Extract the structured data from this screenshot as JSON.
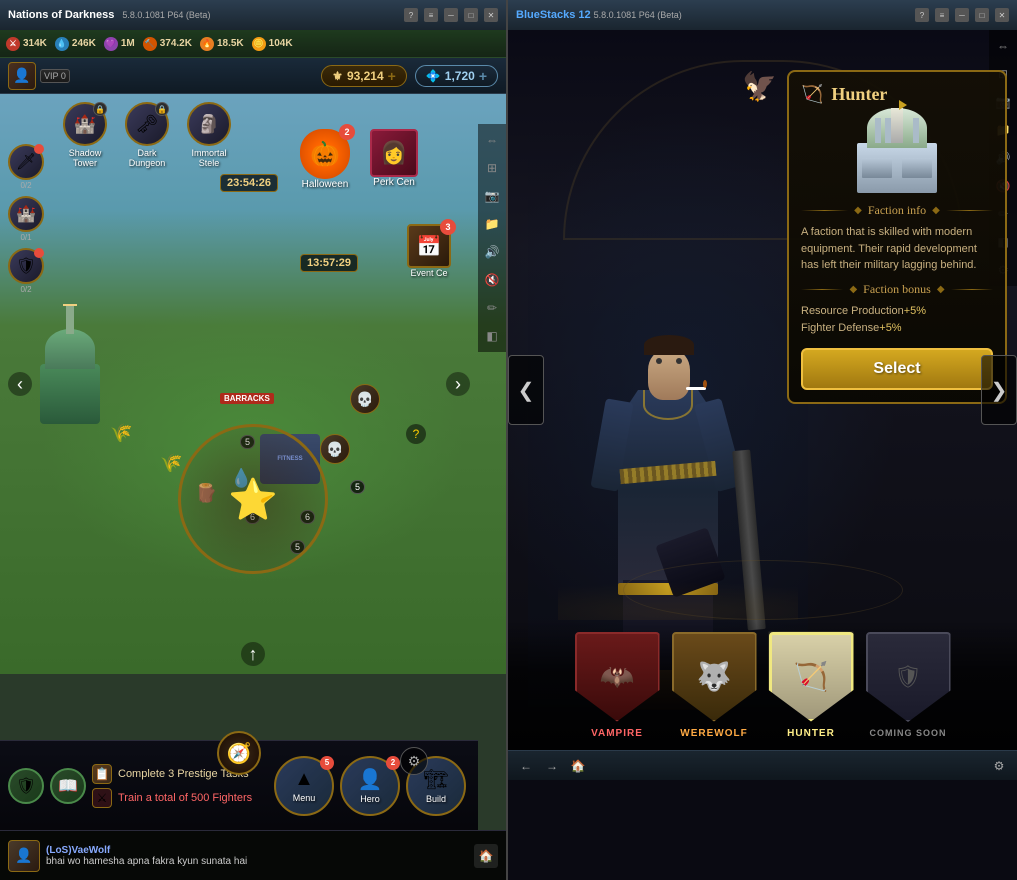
{
  "left_window": {
    "title": "Nations of Darkness",
    "subtitle": "5.8.0.1081 P64 (Beta)",
    "resources": [
      {
        "icon": "⚔",
        "value": "314K",
        "type": "sword"
      },
      {
        "icon": "💧",
        "value": "246K",
        "type": "water"
      },
      {
        "icon": "💎",
        "value": "1M",
        "type": "gem"
      },
      {
        "icon": "🍖",
        "value": "374.2K",
        "type": "food"
      },
      {
        "icon": "🔥",
        "value": "18.5K",
        "type": "fire"
      },
      {
        "icon": "🪙",
        "value": "104K",
        "type": "coin"
      }
    ],
    "gold_amount": "93,214",
    "diamond_amount": "1,720",
    "vip": "VIP 0",
    "map_icons": [
      {
        "label": "Shadow Tower",
        "locked": true
      },
      {
        "label": "Dark Dungeon",
        "locked": true
      },
      {
        "label": "Immortal Stele",
        "locked": false
      }
    ],
    "events": [
      {
        "label": "Halloween",
        "badge": "2"
      },
      {
        "label": "Perk Cen",
        "badge": ""
      },
      {
        "label": "Event Ce",
        "badge": "3"
      }
    ],
    "timers": [
      "23:54:26",
      "13:57:29"
    ],
    "side_icons": [
      {
        "count": "0/2"
      },
      {
        "count": "0/1"
      },
      {
        "count": "0/2"
      }
    ],
    "menu_btn": "Menu",
    "hero_btn": "Hero",
    "build_btn": "Build",
    "hero_badge": "2",
    "quest1": "Complete 3 Prestige Tasks",
    "quest2": "Train a total of 500 Fighters",
    "chat_username": "(LoS)VaeWolf",
    "chat_message": "bhai wo hamesha apna fakra kyun sunata hai"
  },
  "right_window": {
    "title": "BlueStacks 12",
    "subtitle": "5.8.0.1081 P64 (Beta)",
    "faction_name": "Hunter",
    "faction_icon": "🏹",
    "faction_info_header": "Faction info",
    "faction_info_text": "A faction that is skilled with modern equipment. Their rapid development has left their military lagging behind.",
    "faction_bonus_header": "Faction bonus",
    "faction_bonus_1": "Resource Production",
    "faction_bonus_1_val": "+5%",
    "faction_bonus_2": "Fighter Defense",
    "faction_bonus_2_val": "+5%",
    "select_button": "Select",
    "factions": [
      {
        "name": "VAMPIRE",
        "type": "vampire"
      },
      {
        "name": "WEREWOLF",
        "type": "werewolf"
      },
      {
        "name": "HUNTER",
        "type": "hunter"
      },
      {
        "name": "Coming soon",
        "type": "coming-soon"
      }
    ],
    "nav_left": "❮",
    "nav_right": "❯"
  }
}
